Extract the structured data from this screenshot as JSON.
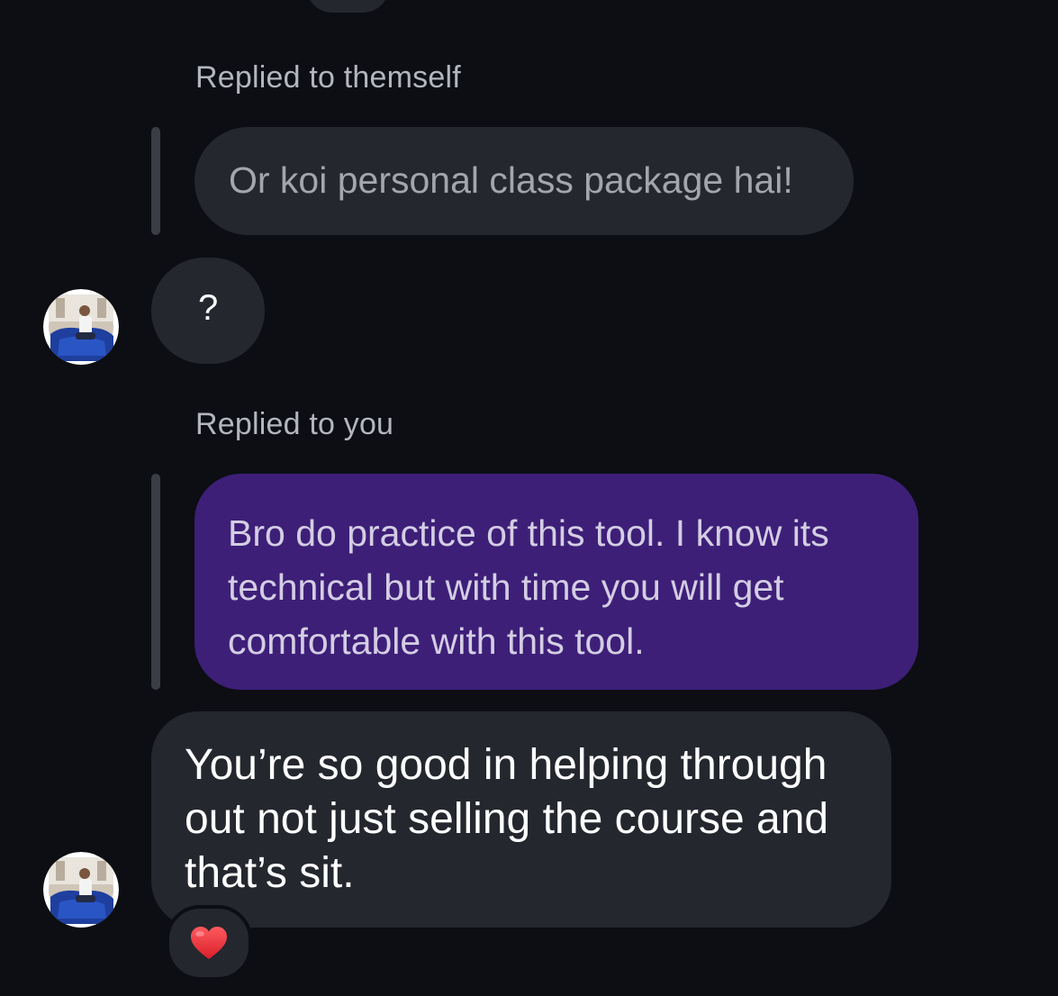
{
  "conversation": {
    "reply_label_1": "Replied to themself",
    "quoted_message_1": "Or koi personal class package hai!",
    "message_question": "?",
    "reply_label_2": "Replied to you",
    "quoted_message_2_lines": [
      "Bro do practice of this tool. I know its",
      "technical but with time you will get",
      "comfortable with this tool."
    ],
    "reply_message_lines": [
      "You’re so good in helping through",
      "out not just selling the course and",
      "that’s sit."
    ],
    "reaction": {
      "emoji": "❤️",
      "icon": "red-heart-icon",
      "color": "#e0303a"
    }
  },
  "colors": {
    "background": "#0c0e13",
    "received_bubble": "#24272e",
    "sent_bubble": "#3d1f78"
  }
}
